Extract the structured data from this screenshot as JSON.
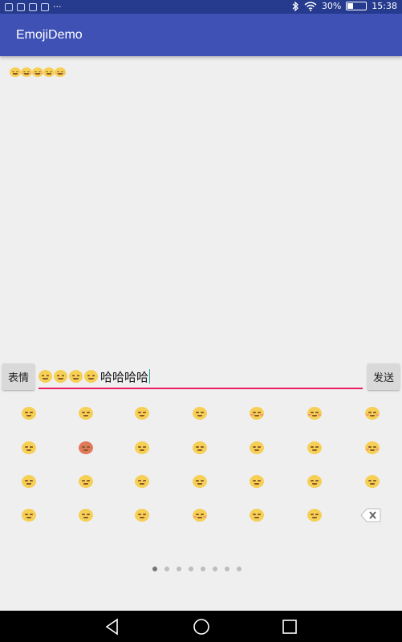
{
  "status_bar": {
    "battery": "30%",
    "time": "15:38",
    "battery_level": 0.3,
    "left_icons": [
      "sim-icon",
      "notification-icon",
      "wifi-notify-icon",
      "app-notify-icon",
      "more-icon"
    ],
    "more_text": "···"
  },
  "app_bar": {
    "title": "EmojiDemo"
  },
  "message": {
    "emojis": [
      "smirk",
      "blush",
      "blush",
      "smirk",
      "blush"
    ]
  },
  "input": {
    "emoji_button": "表情",
    "send_button": "发送",
    "emojis": [
      "confused",
      "confused",
      "confused",
      "confused"
    ],
    "text": "哈哈哈哈",
    "accent_color": "#e91e63"
  },
  "emoji_panel": {
    "rows": [
      [
        "grin",
        "grinning",
        "grimace",
        "tongue",
        "laughing",
        "blush-smile",
        "kiss-blush"
      ],
      [
        "innocent",
        "imp",
        "smile",
        "relieved",
        "wink",
        "expressionless",
        "heart-eyes"
      ],
      [
        "sunglasses",
        "smirk",
        "neutral",
        "unamused",
        "flushed",
        "sweat",
        "pouting"
      ],
      [
        "confused",
        "persevere",
        "astonished",
        "kissing-heart",
        "thinking",
        "tired"
      ]
    ],
    "delete_label": "delete",
    "page_count": 8,
    "current_page": 1
  },
  "nav_bar": {
    "buttons": [
      "back-icon",
      "home-icon",
      "recents-icon"
    ]
  },
  "colors": {
    "primary": "#3f51b5",
    "status_bar": "#263b8e",
    "emoji_yellow": "#f6cf55",
    "background": "#efefef"
  }
}
